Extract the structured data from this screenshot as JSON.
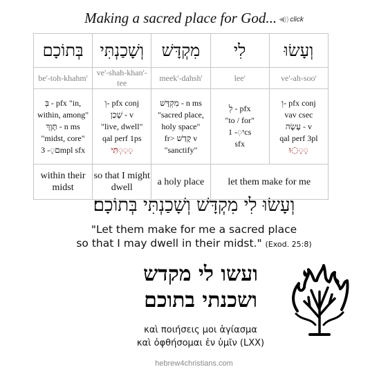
{
  "title": "Making a sacred place for God...",
  "audio": {
    "icon": "speaker-icon",
    "label": "click"
  },
  "table": {
    "columns": [
      {
        "hebrew": "בְּתוֹכָם",
        "translit": "be'-toh-khahm'",
        "parse": [
          "בְּ - pfx \"in,",
          "within, among\"",
          "תָּוֶךְ - n ms",
          "\"midst, core\"",
          "ם◌ָ- 3mpl sfx"
        ]
      },
      {
        "hebrew": "וְשָׁכַנְתִּי",
        "translit": "ve'-shah-khan'-tee",
        "parse": [
          "וְ- pfx conj",
          "שָׁכַן - v",
          "\"live, dwell\"",
          "qal perf 1ps",
          "◌ָ◌ַ◌ְתִּי"
        ]
      },
      {
        "hebrew": "מִקְדָּשׁ",
        "translit": "meek'-dahsh'",
        "parse": [
          "מִקְדָּשׁ - n ms",
          "\"sacred place,",
          "holy space\"",
          "fr> קָדַשׁ v",
          "\"sanctify\""
        ]
      },
      {
        "hebrew": "לִי",
        "translit": "lee'",
        "parse": [
          "לְ - pfx",
          "\"to / for\"",
          "י◌ִ- 1cs",
          "sfx"
        ]
      },
      {
        "hebrew": "וְעָשׂוּ",
        "translit": "ve'-ah-soo'",
        "parse": [
          "וְ- pfx conj",
          "vav csec",
          "עָשָׂה - v",
          "qal perf 3pl",
          "◌ָ◌ָ◌וּ"
        ]
      }
    ],
    "glosses": [
      "within their midst",
      "so that I might dwell",
      "a holy place",
      "let them make for me"
    ]
  },
  "verse_hebrew": "וְעָשׂוּ לִי מִקְדָּשׁ וְשָׁכַנְתִּי בְּתוֹכָם׃",
  "english": {
    "line1": "\"Let them make for me a sacred place",
    "line2": "so that I may dwell in their midst.\"",
    "reference": "(Exod. 25:8)"
  },
  "stam": {
    "line1": "ועשו לי מקדש",
    "line2": "ושכנתי בתוכם"
  },
  "greek": {
    "line1": "καὶ ποιήσεις μοι ἁγίασμα",
    "line2": "καὶ ὀφθήσομαι ἐν ὑμῖν (LXX)"
  },
  "image": {
    "icon": "burning-bush-icon"
  },
  "site": "hebrew4christians.com"
}
